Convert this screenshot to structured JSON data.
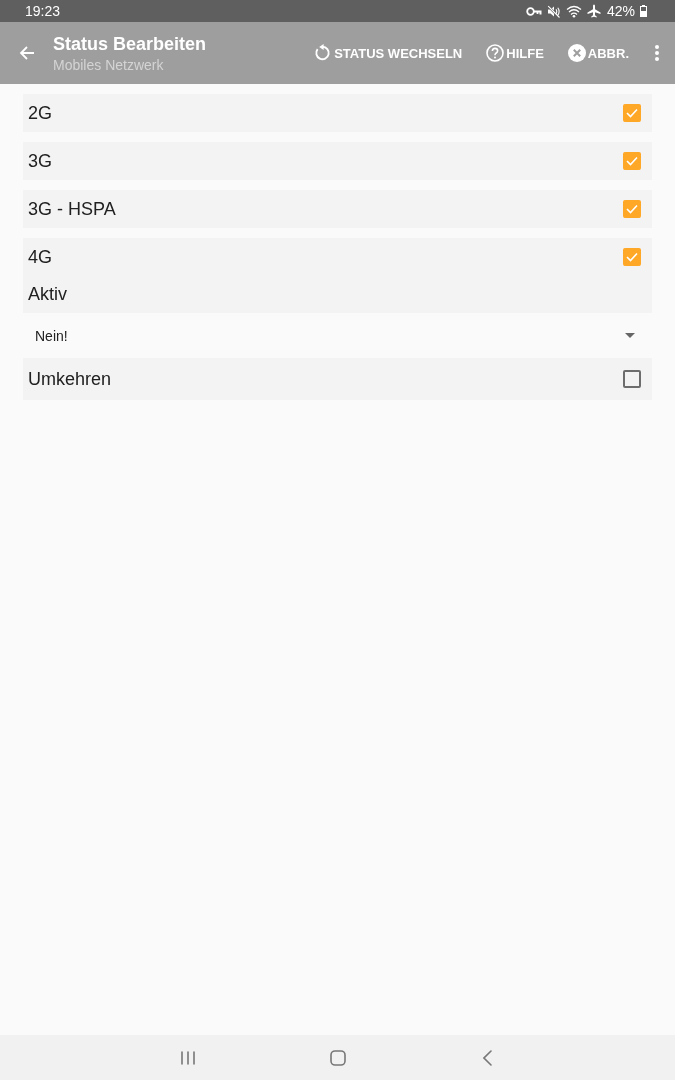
{
  "status_bar": {
    "time": "19:23",
    "battery": "42%"
  },
  "app_bar": {
    "title": "Status Bearbeiten",
    "subtitle": "Mobiles Netzwerk",
    "actions": [
      {
        "kind": "refresh",
        "label": "STATUS WECHSELN"
      },
      {
        "kind": "help",
        "label": "HILFE"
      },
      {
        "kind": "cancel",
        "label": "ABBR."
      }
    ]
  },
  "settings": [
    {
      "kind": "checkbox",
      "label": "2G",
      "checked": true
    },
    {
      "kind": "checkbox",
      "label": "3G",
      "checked": true
    },
    {
      "kind": "checkbox",
      "label": "3G - HSPA",
      "checked": true
    },
    {
      "kind": "checkbox",
      "label": "4G",
      "checked": true
    },
    {
      "kind": "dropdown",
      "label": "Aktiv",
      "value": "Nein!"
    },
    {
      "kind": "checkbox",
      "label": "Umkehren",
      "checked": false
    }
  ]
}
